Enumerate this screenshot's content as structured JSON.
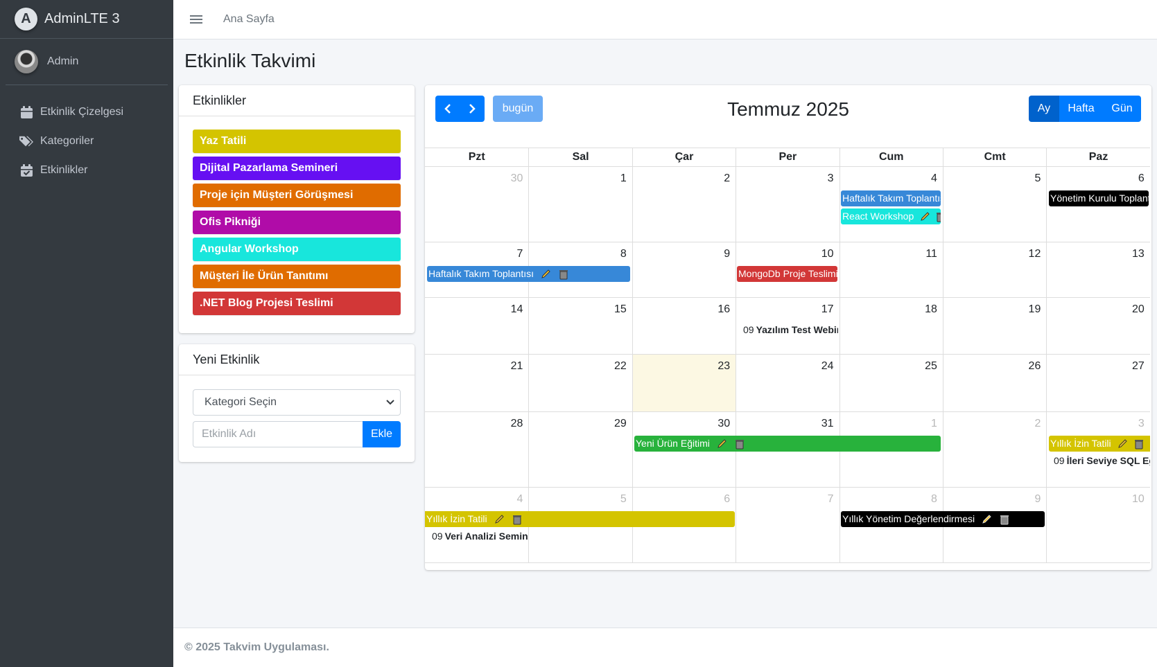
{
  "brand": {
    "name": "AdminLTE 3",
    "logo_letter": "A"
  },
  "user": {
    "name": "Admin"
  },
  "sidebar": {
    "items": [
      {
        "label": "Etkinlik Çizelgesi",
        "icon": "calendar-icon"
      },
      {
        "label": "Kategoriler",
        "icon": "tags-icon"
      },
      {
        "label": "Etkinlikler",
        "icon": "calendar-check-icon"
      }
    ]
  },
  "topbar": {
    "home": "Ana Sayfa"
  },
  "page": {
    "title": "Etkinlik Takvimi"
  },
  "events_card": {
    "title": "Etkinlikler",
    "items": [
      {
        "label": "Yaz Tatili",
        "color": "#d4c400"
      },
      {
        "label": "Dijital Pazarlama Semineri",
        "color": "#6610f2"
      },
      {
        "label": "Proje için Müşteri Görüşmesi",
        "color": "#e06c00"
      },
      {
        "label": "Ofis Pikniği",
        "color": "#b00ca8"
      },
      {
        "label": "Angular Workshop",
        "color": "#18e6dc"
      },
      {
        "label": "Müşteri İle Ürün Tanıtımı",
        "color": "#e06c00"
      },
      {
        "label": ".NET Blog Projesi Teslimi",
        "color": "#d23737"
      }
    ]
  },
  "new_event_card": {
    "title": "Yeni Etkinlik",
    "select_value": "Kategori Seçin",
    "input_placeholder": "Etkinlik Adı",
    "add_label": "Ekle"
  },
  "calendar": {
    "title": "Temmuz 2025",
    "today_label": "bugün",
    "views": [
      "Ay",
      "Hafta",
      "Gün"
    ],
    "active_view": "Ay",
    "weekdays": [
      "Pzt",
      "Sal",
      "Çar",
      "Per",
      "Cum",
      "Cmt",
      "Paz"
    ],
    "weeks": [
      [
        "30",
        "1",
        "2",
        "3",
        "4",
        "5",
        "6"
      ],
      [
        "7",
        "8",
        "9",
        "10",
        "11",
        "12",
        "13"
      ],
      [
        "14",
        "15",
        "16",
        "17",
        "18",
        "19",
        "20"
      ],
      [
        "21",
        "22",
        "23",
        "24",
        "25",
        "26",
        "27"
      ],
      [
        "28",
        "29",
        "30",
        "31",
        "1",
        "2",
        "3"
      ],
      [
        "4",
        "5",
        "6",
        "7",
        "8",
        "9",
        "10"
      ]
    ],
    "events": {
      "w0_haftalik": "Haftalık Takım Toplantısı",
      "w0_react": "React Workshop",
      "w0_yonetim": "Yönetim Kurulu Toplantısı",
      "w1_haftalik": "Haftalık Takım Toplantısı",
      "w1_mongo": "MongoDb Proje Teslimi",
      "w2_test_time": "09",
      "w2_test": "Yazılım Test Webinarı",
      "w4_yeni": "Yeni Ürün Eğitimi",
      "w4_yillik": "Yıllık İzin Tatili",
      "w4_sql_time": "09",
      "w4_sql": "İleri Seviye SQL Eğitimi",
      "w5_yillik": "Yıllık İzin Tatili",
      "w5_veri_time": "09",
      "w5_veri": "Veri Analizi Semineri",
      "w5_yonetim": "Yıllık Yönetim Değerlendirmesi"
    },
    "colors": {
      "blue": "#3788d8",
      "cyan": "#18e6dc",
      "black": "#000000",
      "red": "#d23737",
      "green": "#28b23c",
      "yellow": "#d4c400",
      "today_bg": "#fcf8e3"
    }
  },
  "footer": {
    "text": "© 2025 Takvim Uygulaması."
  }
}
